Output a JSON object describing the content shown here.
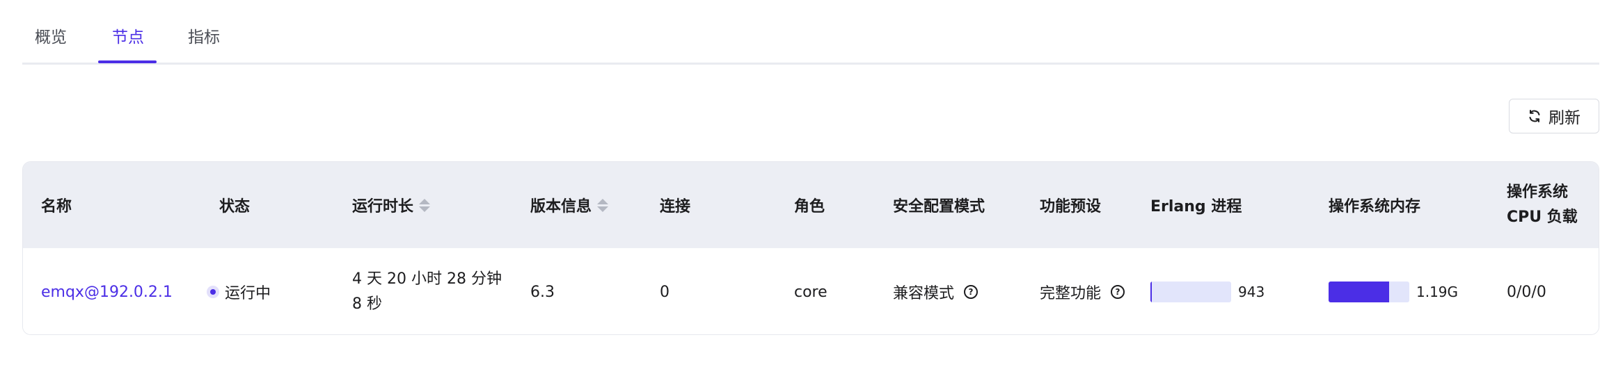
{
  "tabs": [
    {
      "label": "概览",
      "active": false
    },
    {
      "label": "节点",
      "active": true
    },
    {
      "label": "指标",
      "active": false
    }
  ],
  "toolbar": {
    "refresh_label": "刷新",
    "refresh_icon": "refresh-icon"
  },
  "table": {
    "headers": {
      "name": "名称",
      "status": "状态",
      "uptime": "运行时长",
      "version": "版本信息",
      "connections": "连接",
      "role": "角色",
      "security_mode": "安全配置模式",
      "feature_preset": "功能预设",
      "erlang_processes": "Erlang 进程",
      "os_memory": "操作系统内存",
      "os_cpu_load": "操作系统 CPU 负载"
    },
    "rows": [
      {
        "name": "emqx@192.0.2.1",
        "status": "运行中",
        "uptime": "4 天 20 小时 28 分钟 8 秒",
        "version": "6.3",
        "connections": "0",
        "role": "core",
        "security_mode": "兼容模式",
        "feature_preset": "完整功能",
        "erlang_processes": {
          "value": "943",
          "fraction": 0.01
        },
        "os_memory": {
          "value": "1.19G",
          "fraction": 0.75
        },
        "os_cpu_load": "0/0/0"
      }
    ]
  },
  "colors": {
    "accent": "#4b2ee6",
    "header_bg": "#eceef4",
    "bar_track": "#e2e5fb"
  }
}
